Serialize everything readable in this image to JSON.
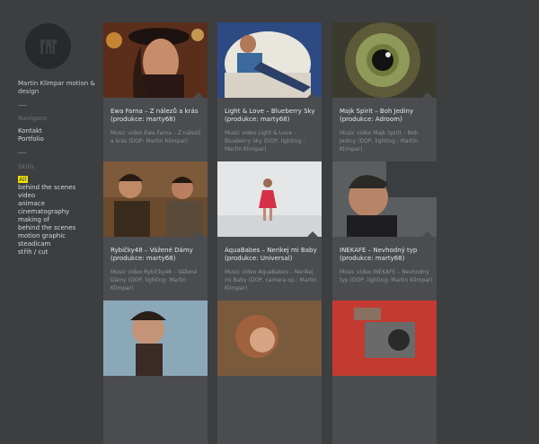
{
  "site": {
    "title": "Martin Klimpar motion & design",
    "logo_icon": "stylized-mk-monogram"
  },
  "navigation": {
    "heading": "Navigace",
    "items": [
      "Kontakt",
      "Portfolio"
    ]
  },
  "skills": {
    "heading": "Skills",
    "items": [
      "All",
      "behind the scenes",
      "video",
      "animace",
      "cinematography",
      "making of",
      "behind the scenes",
      "motion graphic",
      "steadicam",
      "střih / cut"
    ],
    "active": "All"
  },
  "colors": {
    "background": "#3d3e40",
    "card": "#4a4c4f",
    "accent": "#f1e100"
  },
  "cards": [
    {
      "title": "Ewa Farna – Z nálezů a krás (produkce: marty68)",
      "desc": "Music video Ewa Farna – Z nálezů a krás (DOP: Martin Klimpar)"
    },
    {
      "title": "Light & Love – Blueberry Sky (produkce: marty68)",
      "desc": "Music video Light & Love – Blueberry Sky (DOP, lighting : Martin Klimpar)"
    },
    {
      "title": "Majk Spirit – Boh Jediny (produkce: Adroom)",
      "desc": "Music video Majk Spirit – Boh Jediny (DOP, lighting : Martin Klimpar)"
    },
    {
      "title": "Rybičky48 – Vážené Dámy (produkce: marty68)",
      "desc": "Music video Rybičky48 – Vážené Dámy (DOP, lighting: Martin Klimpar)"
    },
    {
      "title": "AquaBabes – Nerikej mi Baby (produkce: Universal)",
      "desc": "Music video AquaBabes – Nerikej mi Baby (DOP, camera op.: Martin Klimpar)"
    },
    {
      "title": "INEKAFE – Nevhodný typ (produkce: marty68)",
      "desc": "Music video INEKAFE – Nevhodný typ (DOP, lighting: Martin Klimpar)"
    },
    {
      "title": "",
      "desc": ""
    },
    {
      "title": "",
      "desc": ""
    },
    {
      "title": "",
      "desc": ""
    }
  ]
}
